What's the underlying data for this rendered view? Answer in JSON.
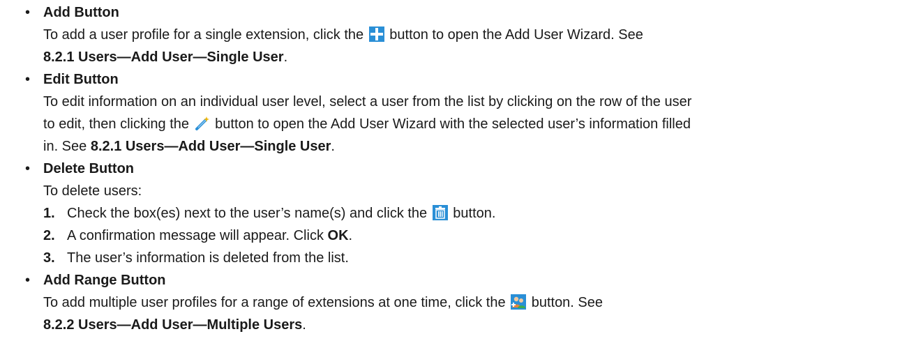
{
  "bullet_char": "•",
  "sections": {
    "add": {
      "heading": "Add Button",
      "text1": "To add a user profile for a single extension, click the",
      "text2": "button to open the Add User Wizard. See",
      "ref": "8.2.1  Users—Add User—Single User",
      "ref_tail": "."
    },
    "edit": {
      "heading": "Edit Button",
      "line1": "To edit information on an individual user level, select a user from the list by clicking on the row of the user",
      "line2a": "to edit, then clicking the",
      "line2b": "button to open the Add User Wizard with the selected user’s information filled",
      "line3a": "in. See",
      "ref": "8.2.1  Users—Add User—Single User",
      "ref_tail": "."
    },
    "delete": {
      "heading": "Delete Button",
      "intro": "To delete users:",
      "steps": [
        {
          "num": "1.",
          "text_a": "Check the box(es) next to the user’s name(s) and click the",
          "text_b": "button."
        },
        {
          "num": "2.",
          "text_a": "A confirmation message will appear. Click",
          "bold": "OK",
          "text_b": "."
        },
        {
          "num": "3.",
          "text_a": "The user’s information is deleted from the list."
        }
      ]
    },
    "range": {
      "heading": "Add Range Button",
      "text1": "To add multiple user profiles for a range of extensions at one time, click the",
      "text2": "button. See",
      "ref": "8.2.2  Users—Add User—Multiple Users",
      "ref_tail": "."
    }
  },
  "icons": {
    "add": "plus-icon",
    "edit": "edit-wand-icon",
    "delete": "trash-icon",
    "range": "multiple-users-icon"
  },
  "colors": {
    "text": "#1a1a1a",
    "icon_blue": "#2a8fd6"
  }
}
